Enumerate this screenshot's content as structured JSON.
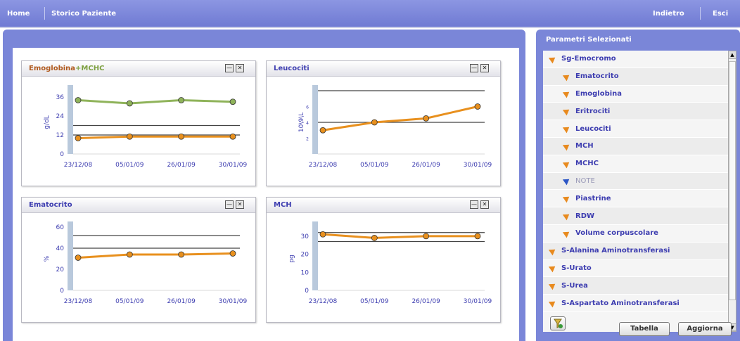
{
  "topbar": {
    "home": "Home",
    "storico": "Storico Paziente",
    "indietro": "Indietro",
    "esci": "Esci"
  },
  "side": {
    "title": "Parametri Selezionati",
    "items": [
      {
        "label": "Sg-Emocromo",
        "level": 0,
        "style": "normal"
      },
      {
        "label": "Ematocrito",
        "level": 1,
        "style": "normal"
      },
      {
        "label": "Emoglobina",
        "level": 1,
        "style": "normal"
      },
      {
        "label": "Eritrociti",
        "level": 1,
        "style": "normal"
      },
      {
        "label": "Leucociti",
        "level": 1,
        "style": "normal"
      },
      {
        "label": "MCH",
        "level": 1,
        "style": "normal"
      },
      {
        "label": "MCHC",
        "level": 1,
        "style": "normal"
      },
      {
        "label": "NOTE",
        "level": 1,
        "style": "muted"
      },
      {
        "label": "Piastrine",
        "level": 1,
        "style": "normal"
      },
      {
        "label": "RDW",
        "level": 1,
        "style": "normal"
      },
      {
        "label": "Volume corpuscolare",
        "level": 1,
        "style": "normal"
      },
      {
        "label": "S-Alanina Aminotransferasi",
        "level": 0,
        "style": "normal"
      },
      {
        "label": "S-Urato",
        "level": 0,
        "style": "normal"
      },
      {
        "label": "S-Urea",
        "level": 0,
        "style": "normal"
      },
      {
        "label": "S-Aspartato Aminotransferasi",
        "level": 0,
        "style": "normal"
      }
    ],
    "tabella": "Tabella",
    "aggiorna": "Aggiorna"
  },
  "chart_data": [
    {
      "type": "line",
      "title": "Emoglobina",
      "title2": "+MCHC",
      "ylabel": "g/dL",
      "categories": [
        "23/12/08",
        "05/01/09",
        "26/01/09",
        "30/01/09"
      ],
      "yticks": [
        "0",
        "12",
        "24",
        "36"
      ],
      "ylim": [
        0,
        40
      ],
      "ref": [
        12,
        18
      ],
      "series": [
        {
          "name": "MCHC",
          "color": "#8fb35a",
          "values": [
            34,
            32,
            34,
            33
          ]
        },
        {
          "name": "Emoglobina",
          "color": "#e8901e",
          "values": [
            10,
            11,
            11,
            11
          ]
        }
      ]
    },
    {
      "type": "line",
      "title": "Leucociti",
      "ylabel": "10\\9\\L",
      "categories": [
        "23/12/08",
        "05/01/09",
        "26/01/09",
        "30/01/09"
      ],
      "yticks": [
        "2",
        "4",
        "6"
      ],
      "ylim": [
        0,
        8
      ],
      "ref": [
        4,
        8
      ],
      "series": [
        {
          "name": "",
          "color": "#e8901e",
          "values": [
            3.0,
            4.0,
            4.5,
            6.0
          ]
        }
      ]
    },
    {
      "type": "line",
      "title": "Ematocrito",
      "ylabel": "%",
      "categories": [
        "23/12/08",
        "05/01/09",
        "26/01/09",
        "30/01/09"
      ],
      "yticks": [
        "0",
        "20",
        "40",
        "60"
      ],
      "ylim": [
        0,
        60
      ],
      "ref": [
        40,
        52
      ],
      "series": [
        {
          "name": "",
          "color": "#e8901e",
          "values": [
            31,
            34,
            34,
            35
          ]
        }
      ]
    },
    {
      "type": "line",
      "title": "MCH",
      "ylabel": "pg",
      "categories": [
        "23/12/08",
        "05/01/09",
        "26/01/09",
        "30/01/09"
      ],
      "yticks": [
        "0",
        "10",
        "20",
        "30"
      ],
      "ylim": [
        0,
        35
      ],
      "ref": [
        27,
        32
      ],
      "series": [
        {
          "name": "",
          "color": "#e8901e",
          "values": [
            31,
            29,
            30,
            30
          ]
        }
      ]
    }
  ]
}
